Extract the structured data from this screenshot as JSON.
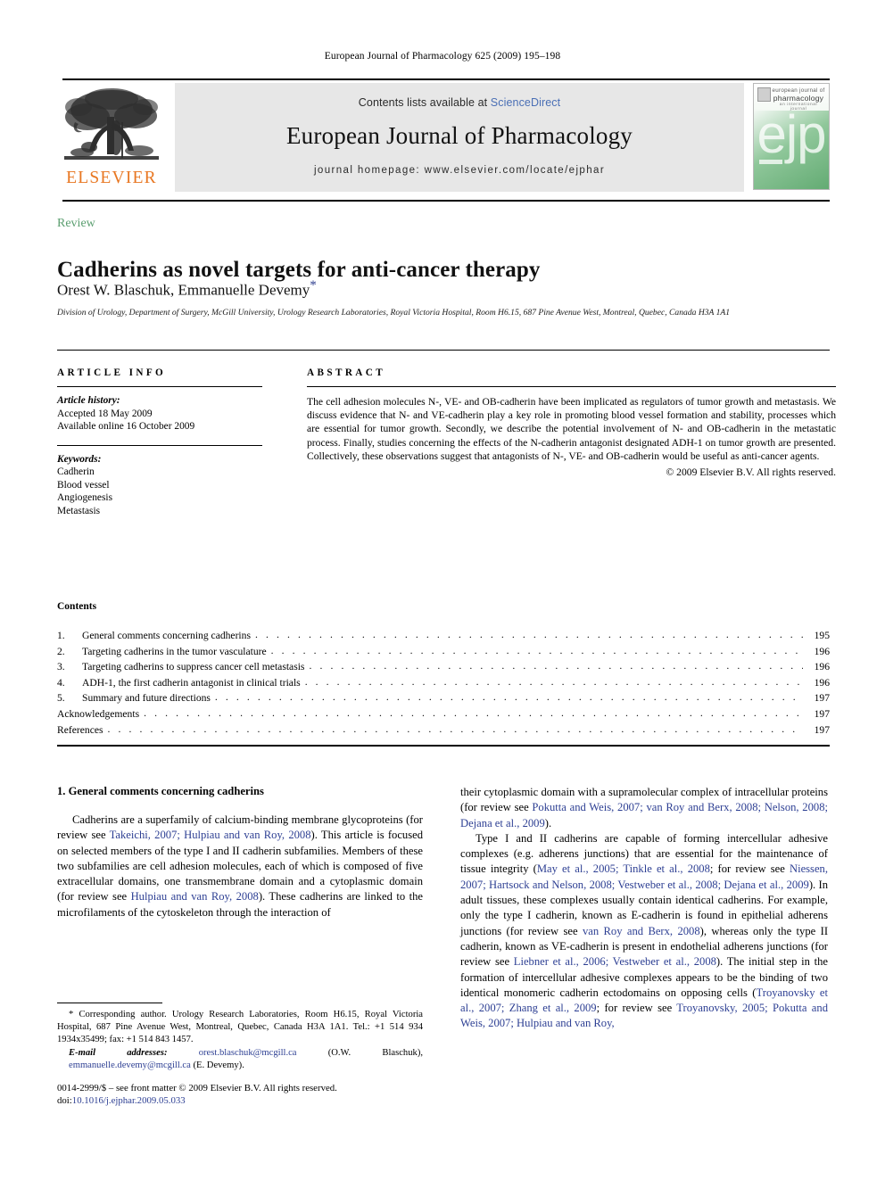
{
  "running_head": "European Journal of Pharmacology 625 (2009) 195–198",
  "masthead": {
    "contents_prefix": "Contents lists available at ",
    "sciencedirect": "ScienceDirect",
    "journal_title": "European Journal of Pharmacology",
    "homepage": "journal homepage: www.elsevier.com/locate/ejphar",
    "elsevier_wordmark": "ELSEVIER",
    "cover": {
      "line1": "european journal of",
      "line2": "pharmacology",
      "line3": "an international journal",
      "monogram": "ejp"
    }
  },
  "article": {
    "type_label": "Review",
    "title": "Cadherins as novel targets for anti-cancer therapy",
    "authors": "Orest W. Blaschuk, Emmanuelle Devemy",
    "corresponding_marker": "*",
    "affiliation": "Division of Urology, Department of Surgery, McGill University, Urology Research Laboratories, Royal Victoria Hospital, Room H6.15, 687 Pine Avenue West, Montreal, Quebec, Canada H3A 1A1"
  },
  "article_info": {
    "heading": "ARTICLE INFO",
    "history_label": "Article history:",
    "accepted": "Accepted 18 May 2009",
    "available_online": "Available online 16 October 2009",
    "keywords_label": "Keywords:",
    "keywords": [
      "Cadherin",
      "Blood vessel",
      "Angiogenesis",
      "Metastasis"
    ]
  },
  "abstract": {
    "heading": "ABSTRACT",
    "text": "The cell adhesion molecules N-, VE- and OB-cadherin have been implicated as regulators of tumor growth and metastasis. We discuss evidence that N- and VE-cadherin play a key role in promoting blood vessel formation and stability, processes which are essential for tumor growth. Secondly, we describe the potential involvement of N- and OB-cadherin in the metastatic process. Finally, studies concerning the effects of the N-cadherin antagonist designated ADH-1 on tumor growth are presented. Collectively, these observations suggest that antagonists of N-, VE- and OB-cadherin would be useful as anti-cancer agents.",
    "copyright": "© 2009 Elsevier B.V. All rights reserved."
  },
  "contents": {
    "heading": "Contents",
    "items": [
      {
        "num": "1.",
        "label": "General comments concerning cadherins",
        "page": "195"
      },
      {
        "num": "2.",
        "label": "Targeting cadherins in the tumor vasculature",
        "page": "196"
      },
      {
        "num": "3.",
        "label": "Targeting cadherins to suppress cancer cell metastasis",
        "page": "196"
      },
      {
        "num": "4.",
        "label": "ADH-1, the first cadherin antagonist in clinical trials",
        "page": "196"
      },
      {
        "num": "5.",
        "label": "Summary and future directions",
        "page": "197"
      },
      {
        "num": "",
        "label": "Acknowledgements",
        "page": "197"
      },
      {
        "num": "",
        "label": "References",
        "page": "197"
      }
    ]
  },
  "body": {
    "section1_heading": "1. General comments concerning cadherins",
    "left_p1_a": "Cadherins are a superfamily of calcium-binding membrane glycoproteins (for review see ",
    "left_p1_cite1": "Takeichi, 2007; Hulpiau and van Roy, 2008",
    "left_p1_b": "). This article is focused on selected members of the type I and II cadherin subfamilies. Members of these two subfamilies are cell adhesion molecules, each of which is composed of five extracellular domains, one transmembrane domain and a cytoplasmic domain (for review see ",
    "left_p1_cite2": "Hulpiau and van Roy, 2008",
    "left_p1_c": "). These cadherins are linked to the microfilaments of the cytoskeleton through the interaction of",
    "right_p1_a": "their cytoplasmic domain with a supramolecular complex of intracellular proteins (for review see ",
    "right_p1_cite1": "Pokutta and Weis, 2007; van Roy and Berx, 2008; Nelson, 2008; Dejana et al., 2009",
    "right_p1_b": ").",
    "right_p2_a": "Type I and II cadherins are capable of forming intercellular adhesive complexes (e.g. adherens junctions) that are essential for the maintenance of tissue integrity (",
    "right_p2_cite1": "May et al., 2005; Tinkle et al., 2008",
    "right_p2_b": "; for review see ",
    "right_p2_cite2": "Niessen, 2007; Hartsock and Nelson, 2008; Vestweber et al., 2008; Dejana et al., 2009",
    "right_p2_c": "). In adult tissues, these complexes usually contain identical cadherins. For example, only the type I cadherin, known as E-cadherin is found in epithelial adherens junctions (for review see ",
    "right_p2_cite3": "van Roy and Berx, 2008",
    "right_p2_d": "), whereas only the type II cadherin, known as VE-cadherin is present in endothelial adherens junctions (for review see ",
    "right_p2_cite4": "Liebner et al., 2006; Vestweber et al., 2008",
    "right_p2_e": "). The initial step in the formation of intercellular adhesive complexes appears to be the binding of two identical monomeric cadherin ectodomains on opposing cells (",
    "right_p2_cite5": "Troyanovsky et al., 2007; Zhang et al., 2009",
    "right_p2_f": "; for review see ",
    "right_p2_cite6": "Troyanovsky, 2005; Pokutta and Weis, 2007; Hulpiau and van Roy,"
  },
  "footnote": {
    "star": "*",
    "corresponding": " Corresponding author. Urology Research Laboratories, Room H6.15, Royal Victoria Hospital, 687 Pine Avenue West, Montreal, Quebec, Canada H3A 1A1. Tel.: +1 514 934 1934x35499; fax: +1 514 843 1457.",
    "email_label": "E-mail addresses:",
    "email1": "orest.blaschuk@mcgill.ca",
    "email1_owner": " (O.W. Blaschuk), ",
    "email2": "emmanuelle.devemy@mcgill.ca",
    "email2_owner": " (E. Devemy)."
  },
  "footer": {
    "issn_line": "0014-2999/$ – see front matter © 2009 Elsevier B.V. All rights reserved.",
    "doi_label": "doi:",
    "doi_value": "10.1016/j.ejphar.2009.05.033"
  },
  "colors": {
    "link_blue": "#2d3f93",
    "sciencedirect_blue": "#4a6fb5",
    "review_green": "#5a9e6f",
    "elsevier_orange": "#E87722",
    "masthead_gray": "#e7e7e7"
  }
}
